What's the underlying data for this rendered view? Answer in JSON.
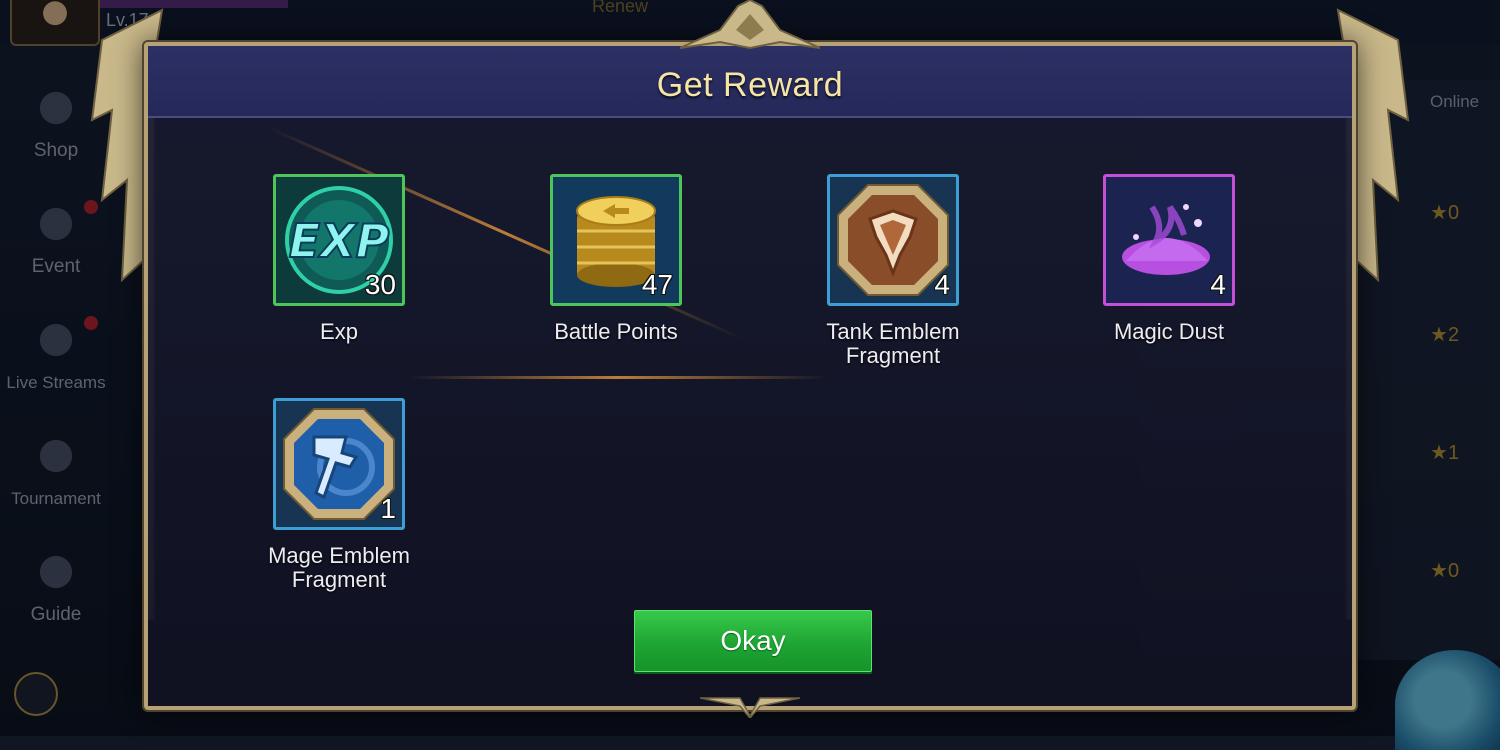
{
  "background": {
    "level": "Lv.17",
    "renew": "Renew",
    "online": "Online",
    "sidebar": [
      {
        "label": "Shop"
      },
      {
        "label": "Event"
      },
      {
        "label": "Live Streams"
      },
      {
        "label": "Tournament"
      },
      {
        "label": "Guide"
      }
    ],
    "friend_stars": [
      "0",
      "2",
      "1",
      "0"
    ]
  },
  "modal": {
    "title": "Get Reward",
    "rewards": [
      {
        "name": "Exp",
        "count": "30",
        "icon": "exp-icon"
      },
      {
        "name": "Battle Points",
        "count": "47",
        "icon": "battle-points-coins-icon"
      },
      {
        "name": "Tank Emblem Fragment",
        "count": "4",
        "icon": "tank-emblem-icon"
      },
      {
        "name": "Magic Dust",
        "count": "4",
        "icon": "magic-dust-icon"
      },
      {
        "name": "Mage Emblem Fragment",
        "count": "1",
        "icon": "mage-emblem-icon"
      }
    ],
    "okay_label": "Okay"
  },
  "colors": {
    "title": "#f6e6a6",
    "button": "#1ea534",
    "frame": "#b6a274"
  }
}
